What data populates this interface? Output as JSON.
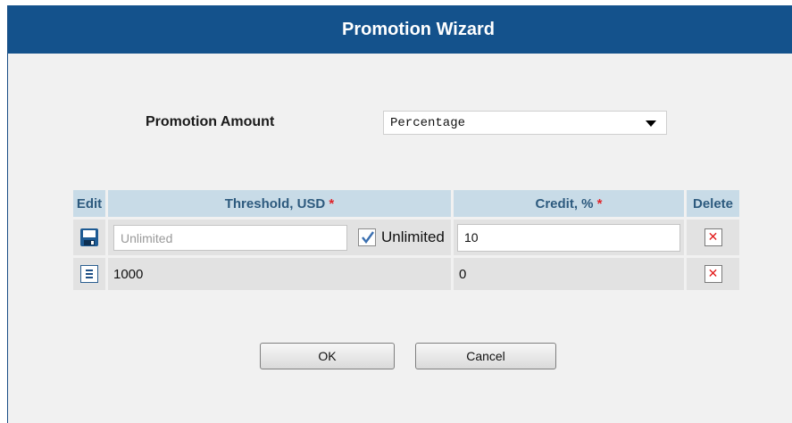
{
  "dialog": {
    "title": "Promotion Wizard"
  },
  "promotion_amount": {
    "label": "Promotion Amount",
    "selected": "Percentage"
  },
  "table": {
    "headers": {
      "edit": "Edit",
      "threshold": "Threshold, USD",
      "credit": "Credit, %",
      "delete": "Delete",
      "required_mark": "*"
    },
    "edit_row": {
      "threshold_placeholder": "Unlimited",
      "unlimited_checked": true,
      "unlimited_label": "Unlimited",
      "credit_value": "10"
    },
    "rows": [
      {
        "threshold": "1000",
        "credit": "0"
      }
    ]
  },
  "buttons": {
    "ok": "OK",
    "cancel": "Cancel"
  },
  "colors": {
    "titlebar": "#14528c",
    "header_bg": "#c8dbe7",
    "header_text": "#2d5a7e",
    "required": "#e0242a",
    "delete_x": "#e21b1b"
  },
  "icons": {
    "save": "save-icon",
    "edit": "list-icon",
    "delete": "delete-icon",
    "dropdown": "caret-down-icon"
  }
}
